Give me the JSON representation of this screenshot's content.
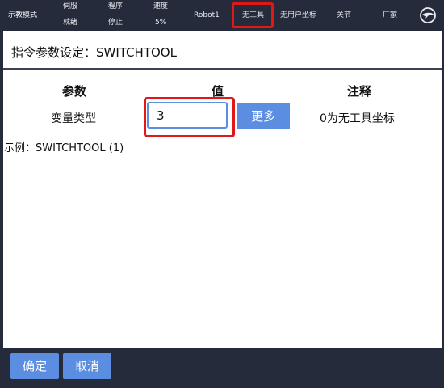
{
  "topbar": {
    "mode": "示教模式",
    "servo_label": "伺服",
    "servo_status": "就绪",
    "program_label": "程序",
    "program_status": "停止",
    "speed_label": "速度",
    "speed_value": "5%",
    "robot": "Robot1",
    "tool": "无工具",
    "user_coord": "无用户坐标",
    "joint": "关节",
    "vendor": "厂家",
    "logo_icon": "eagle-logo-icon"
  },
  "dialog": {
    "title": "指令参数设定：SWITCHTOOL",
    "headers": {
      "param": "参数",
      "value": "值",
      "note": "注释"
    },
    "row": {
      "param": "变量类型",
      "value": "3",
      "more_label": "更多",
      "note": "0为无工具坐标"
    },
    "example": "示例：SWITCHTOOL (1)"
  },
  "footer": {
    "confirm": "确定",
    "cancel": "取消"
  },
  "colors": {
    "bar_bg": "#252b3a",
    "accent": "#5b8ee0",
    "highlight": "#e01818"
  }
}
